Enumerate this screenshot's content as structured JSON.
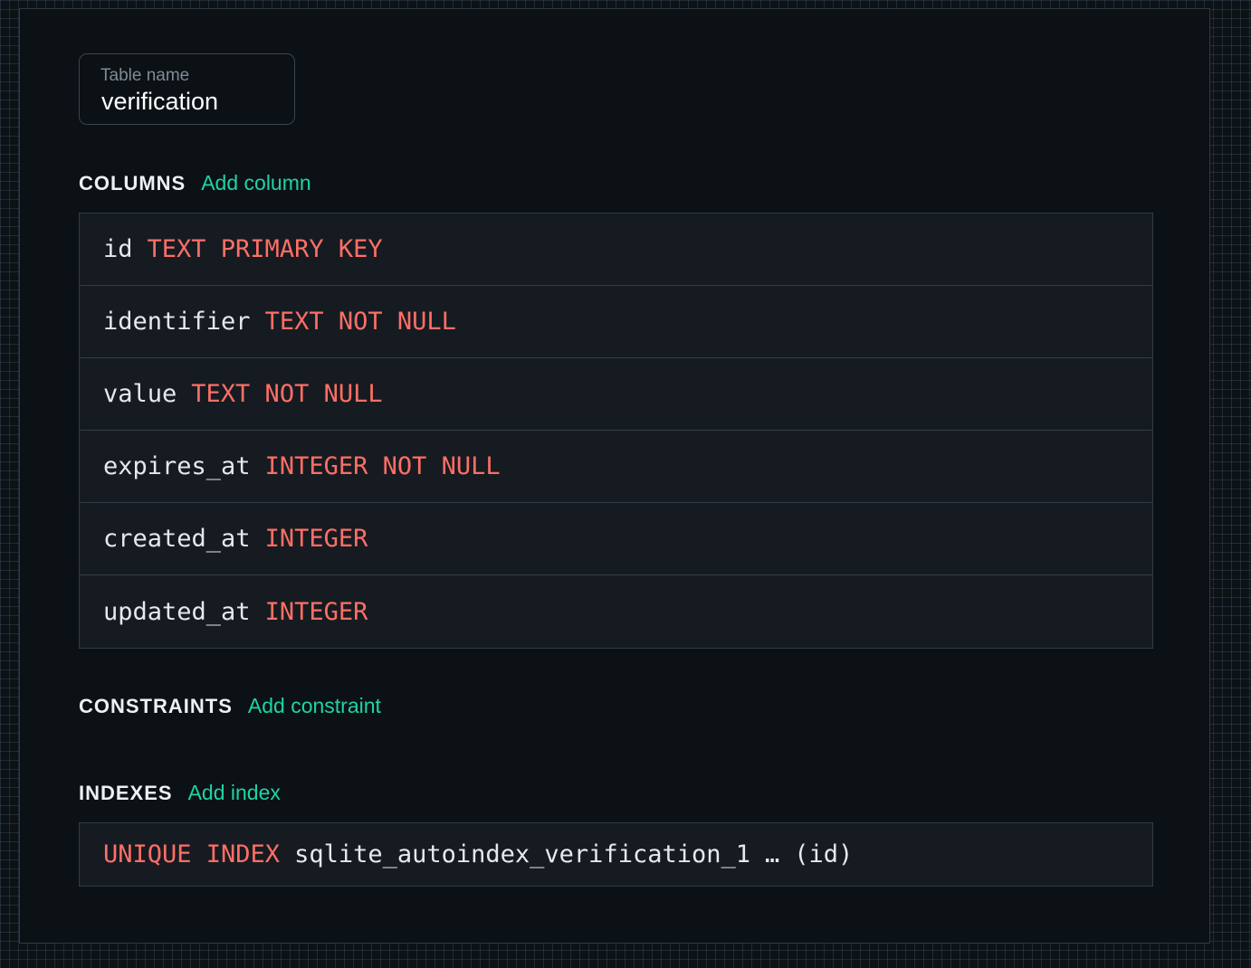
{
  "table_name": {
    "label": "Table name",
    "value": "verification"
  },
  "columns": {
    "title": "COLUMNS",
    "add_label": "Add column",
    "items": [
      {
        "name": "id",
        "type": "TEXT PRIMARY KEY"
      },
      {
        "name": "identifier",
        "type": "TEXT NOT NULL"
      },
      {
        "name": "value",
        "type": "TEXT NOT NULL"
      },
      {
        "name": "expires_at",
        "type": "INTEGER NOT NULL"
      },
      {
        "name": "created_at",
        "type": "INTEGER"
      },
      {
        "name": "updated_at",
        "type": "INTEGER"
      }
    ]
  },
  "constraints": {
    "title": "CONSTRAINTS",
    "add_label": "Add constraint"
  },
  "indexes": {
    "title": "INDEXES",
    "add_label": "Add index",
    "items": [
      {
        "kind": "UNIQUE INDEX",
        "name": "sqlite_autoindex_verification_1",
        "ellipsis": "…",
        "columns": "(id)"
      }
    ]
  },
  "colors": {
    "background": "#0c1115",
    "accent": "#1fd3a6",
    "keyword": "#ff6f66",
    "text": "#e6e9ec"
  }
}
